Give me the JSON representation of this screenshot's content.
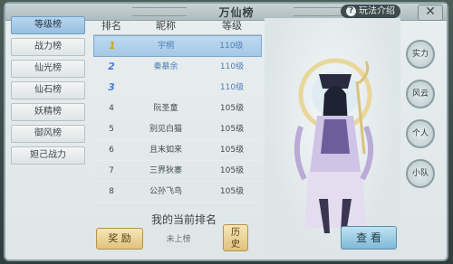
{
  "window": {
    "title": "万仙榜",
    "help_label": "玩法介绍",
    "close_label": "✕"
  },
  "categories": [
    {
      "label": "等级榜",
      "active": true
    },
    {
      "label": "战力榜",
      "active": false
    },
    {
      "label": "仙光榜",
      "active": false
    },
    {
      "label": "仙石榜",
      "active": false
    },
    {
      "label": "妖精榜",
      "active": false
    },
    {
      "label": "御风榜",
      "active": false
    },
    {
      "label": "妲己战力",
      "active": false
    }
  ],
  "table": {
    "headers": [
      "排名",
      "昵称",
      "等级"
    ],
    "rows": [
      {
        "rank": "1",
        "name": "宇桐",
        "level": "110级"
      },
      {
        "rank": "2",
        "name": "秦慕余",
        "level": "110级"
      },
      {
        "rank": "3",
        "name": "",
        "level": "110级"
      },
      {
        "rank": "4",
        "name": "阮圣童",
        "level": "105级"
      },
      {
        "rank": "5",
        "name": "别见白猫",
        "level": "105级"
      },
      {
        "rank": "6",
        "name": "且末如来",
        "level": "105级"
      },
      {
        "rank": "7",
        "name": "三界狄寨",
        "level": "105级"
      },
      {
        "rank": "8",
        "name": "公孙飞鸟",
        "level": "105级"
      }
    ]
  },
  "my_rank": {
    "title": "我的当前排名",
    "status": "未上榜",
    "reward_label": "奖 励",
    "history_label": "历\n史"
  },
  "character": {
    "view_label": "查 看"
  },
  "side_buttons": [
    {
      "label": "实力"
    },
    {
      "label": "风云"
    },
    {
      "label": "个人"
    },
    {
      "label": "小队"
    }
  ]
}
